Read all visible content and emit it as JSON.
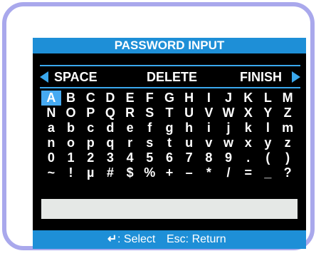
{
  "title": "PASSWORD INPUT",
  "controls": {
    "space": "SPACE",
    "delete": "DELETE",
    "finish": "FINISH"
  },
  "keyboard": {
    "rows": [
      [
        "A",
        "B",
        "C",
        "D",
        "E",
        "F",
        "G",
        "H",
        "I",
        "J",
        "K",
        "L",
        "M"
      ],
      [
        "N",
        "O",
        "P",
        "Q",
        "R",
        "S",
        "T",
        "U",
        "V",
        "W",
        "X",
        "Y",
        "Z"
      ],
      [
        "a",
        "b",
        "c",
        "d",
        "e",
        "f",
        "g",
        "h",
        "i",
        "j",
        "k",
        "l",
        "m"
      ],
      [
        "n",
        "o",
        "p",
        "q",
        "r",
        "s",
        "t",
        "u",
        "v",
        "w",
        "x",
        "y",
        "z"
      ],
      [
        "0",
        "1",
        "2",
        "3",
        "4",
        "5",
        "6",
        "7",
        "8",
        "9",
        ".",
        "(",
        ")"
      ],
      [
        "~",
        "!",
        "µ",
        "#",
        "$",
        "%",
        "+",
        "–",
        "*",
        "/",
        "=",
        "_",
        "?"
      ]
    ],
    "selected": "A"
  },
  "input": {
    "value": ""
  },
  "footer": {
    "select_label": ": Select",
    "return_label": "Esc: Return"
  },
  "colors": {
    "accent": "#1e8fd7",
    "bezel": "#a9a8ec",
    "selection": "#46aaf2",
    "input_bg": "#e5e8e6"
  }
}
